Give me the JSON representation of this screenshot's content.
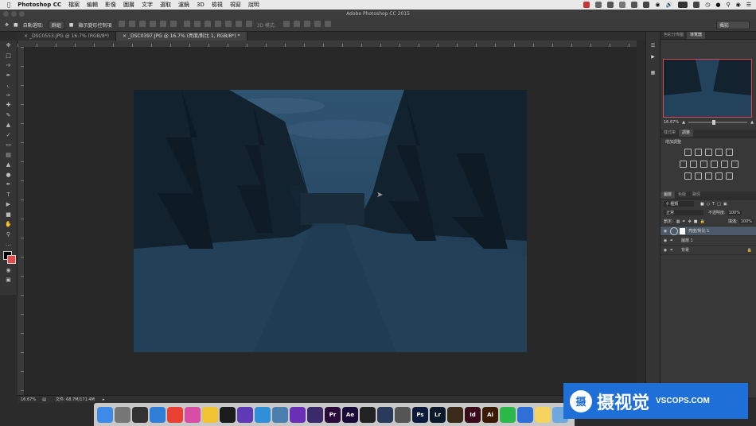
{
  "colors": {
    "accent_selection": "#4d5a6a",
    "watermark_blue": "#1f6fd8",
    "photo_sky": "#2f5472",
    "photo_snow": "#1f3d55"
  },
  "menubar": {
    "app_name": "Photoshop CC",
    "items": [
      "檔案",
      "編輯",
      "影像",
      "圖層",
      "文字",
      "選取",
      "濾鏡",
      "3D",
      "檢視",
      "視窗",
      "說明"
    ]
  },
  "window": {
    "title": "Adobe Photoshop CC 2015"
  },
  "options_bar": {
    "auto_select_label": "自動選取:",
    "auto_select_value": "群組",
    "show_transform_label": "顯示變形控制項",
    "mode_3d_label": "3D 模式:",
    "workspace_value": "攝影"
  },
  "tabs": [
    {
      "label": "_DSC0553.JPG @ 16.7% (RGB/8*)"
    },
    {
      "label": "_DSC0397.JPG @ 16.7% (亮度/對比 1, RGB/8*) *"
    }
  ],
  "status": {
    "zoom": "16.67%",
    "doc_size": "文件: 68.7M/171.4M"
  },
  "navigator": {
    "tabs": [
      "色彩分佈圖",
      "導覽器"
    ],
    "active_tab": "導覽器",
    "zoom": "16.67%"
  },
  "adjustments": {
    "tabs": [
      "樣式庫",
      "調整"
    ],
    "active_tab": "調整",
    "header": "增加調整"
  },
  "layers_panel": {
    "tabs": [
      "圖層",
      "色版",
      "路徑"
    ],
    "active_tab": "圖層",
    "filter_kind": "種類",
    "blend_mode": "正常",
    "opacity_label": "不透明度:",
    "opacity_value": "100%",
    "lock_label": "鎖定:",
    "fill_label": "填滿:",
    "fill_value": "100%",
    "layers": [
      {
        "name": "亮度/對比 1",
        "selected": true
      },
      {
        "name": "圖層 1",
        "selected": false
      },
      {
        "name": "背景",
        "selected": false,
        "locked": true
      }
    ]
  },
  "dock": {
    "items": [
      {
        "label": "",
        "icon": "finder-icon",
        "color": "#3d8be6"
      },
      {
        "label": "",
        "icon": "system-prefs-icon",
        "color": "#777"
      },
      {
        "label": "",
        "icon": "mission-control-icon",
        "color": "#333"
      },
      {
        "label": "",
        "icon": "safari-icon",
        "color": "#2f7fd8"
      },
      {
        "label": "",
        "icon": "chrome-icon",
        "color": "#e94235"
      },
      {
        "label": "",
        "icon": "itunes-icon",
        "color": "#d84ea6"
      },
      {
        "label": "",
        "icon": "photos-icon",
        "color": "#f1c232"
      },
      {
        "label": "",
        "icon": "activity-monitor-icon",
        "color": "#1b1b1b"
      },
      {
        "label": "",
        "icon": "siri-icon",
        "color": "#5e3bb5"
      },
      {
        "label": "",
        "icon": "app-store-icon",
        "color": "#2f8fd8"
      },
      {
        "label": "",
        "icon": "preview-icon",
        "color": "#4a7fb0"
      },
      {
        "label": "",
        "icon": "imovie-icon",
        "color": "#6a2fb5"
      },
      {
        "label": "",
        "icon": "motion-icon",
        "color": "#3a2a6a"
      },
      {
        "label": "Pr",
        "icon": "premiere-icon",
        "color": "#2a0a3a"
      },
      {
        "label": "Ae",
        "icon": "after-effects-icon",
        "color": "#1a0a3a"
      },
      {
        "label": "",
        "icon": "final-cut-icon",
        "color": "#222"
      },
      {
        "label": "",
        "icon": "davinci-icon",
        "color": "#2a3a5a"
      },
      {
        "label": "",
        "icon": "compressor-icon",
        "color": "#555"
      },
      {
        "label": "Ps",
        "icon": "photoshop-icon",
        "color": "#0a1a3a"
      },
      {
        "label": "Lr",
        "icon": "lightroom-icon",
        "color": "#0a1a2a"
      },
      {
        "label": "",
        "icon": "bridge-icon",
        "color": "#3a2a1a"
      },
      {
        "label": "Id",
        "icon": "indesign-icon",
        "color": "#3a0a1a"
      },
      {
        "label": "Ai",
        "icon": "illustrator-icon",
        "color": "#3a1a00"
      },
      {
        "label": "",
        "icon": "evernote-icon",
        "color": "#2db84b"
      },
      {
        "label": "",
        "icon": "keynote-icon",
        "color": "#2f6fd8"
      },
      {
        "label": "",
        "icon": "notes-icon",
        "color": "#f4d35e"
      },
      {
        "label": "",
        "icon": "mail-icon",
        "color": "#6fa8dc"
      }
    ]
  },
  "watermark": {
    "logo_char": "摄",
    "text_cn": "摄视觉",
    "text_en": "VSCOPS.COM"
  }
}
